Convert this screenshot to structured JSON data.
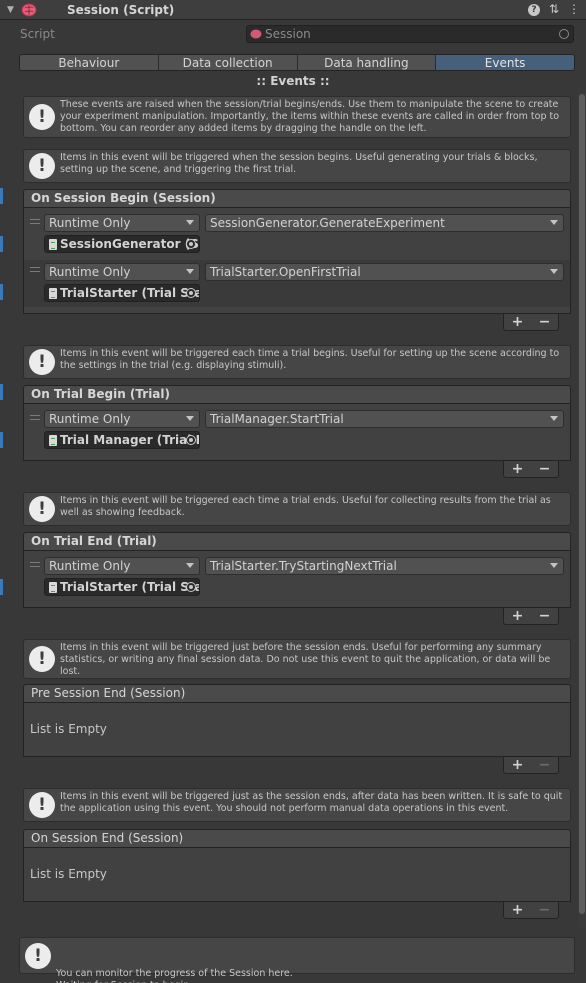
{
  "header": {
    "title": "Session (Script)",
    "help_icon": "help-icon",
    "preset_icon": "preset-icon",
    "menu_icon": "kebab-menu-icon"
  },
  "script": {
    "label": "Script",
    "value": "Session"
  },
  "tabs": [
    "Behaviour",
    "Data collection",
    "Data handling",
    "Events"
  ],
  "active_tab": "Events",
  "section_title": ":: Events ::",
  "intro_help": "These events are raised when the session/trial begins/ends. Use them to manipulate the scene to create your experiment manipulation. Importantly, the items within these events are called in order from top to bottom. You can reorder any added items by dragging the handle on the left.",
  "events": [
    {
      "help": "Items in this event will be triggered when the session begins. Useful generating your trials & blocks, setting up the scene, and triggering the first trial.",
      "title": "On Session Begin (Session)",
      "entries": [
        {
          "mode": "Runtime Only",
          "function": "SessionGenerator.GenerateExperiment",
          "target": "SessionGenerator (S"
        },
        {
          "mode": "Runtime Only",
          "function": "TrialStarter.OpenFirstTrial",
          "target": "TrialStarter (Trial Sta"
        }
      ]
    },
    {
      "help": "Items in this event will be triggered each time a trial begins. Useful for setting up the scene according to the settings in the trial (e.g. displaying stimuli).",
      "title": "On Trial Begin (Trial)",
      "entries": [
        {
          "mode": "Runtime Only",
          "function": "TrialManager.StartTrial",
          "target": "Trial Manager (Trial I"
        }
      ]
    },
    {
      "help": "Items in this event will be triggered each time a trial ends. Useful for collecting results from the trial as well as showing feedback.",
      "title": "On Trial End (Trial)",
      "entries": [
        {
          "mode": "Runtime Only",
          "function": "TrialStarter.TryStartingNextTrial",
          "target": "TrialStarter (Trial Sta"
        }
      ]
    },
    {
      "help": "Items in this event will be triggered just before the session ends. Useful for performing any summary statistics, or writing any final session data. Do not use this event to quit the application, or data will be lost.",
      "title": "Pre Session End (Session)",
      "empty": "List is Empty"
    },
    {
      "help": "Items in this event will be triggered just as the session ends, after data has been written. It is safe to quit the application using this event. You should not perform manual data operations in this event.",
      "title": "On Session End (Session)",
      "empty": "List is Empty"
    }
  ],
  "footer_buttons": {
    "add": "+",
    "remove": "−"
  },
  "status": "You can monitor the progress of the Session here.\nWaiting for Session to begin...",
  "colors": {
    "accent": "#46607c",
    "background": "#383838",
    "panel": "#414141"
  }
}
